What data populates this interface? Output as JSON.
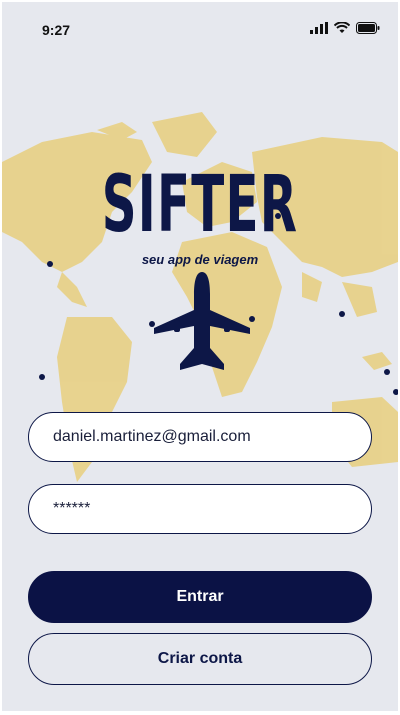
{
  "status_bar": {
    "time": "9:27"
  },
  "brand": {
    "logo": "SIFTER",
    "tagline": "seu app de viagem"
  },
  "login": {
    "email_value": "daniel.martinez@gmail.com",
    "password_value": "******"
  },
  "actions": {
    "primary_label": "Entrar",
    "secondary_label": "Criar conta"
  },
  "colors": {
    "brand": "#0d1747",
    "map_land": "#e8cf7e",
    "background": "#e6e8ee"
  },
  "icons": [
    "signal-icon",
    "wifi-icon",
    "battery-icon",
    "airplane-icon",
    "map-pin-icon"
  ]
}
